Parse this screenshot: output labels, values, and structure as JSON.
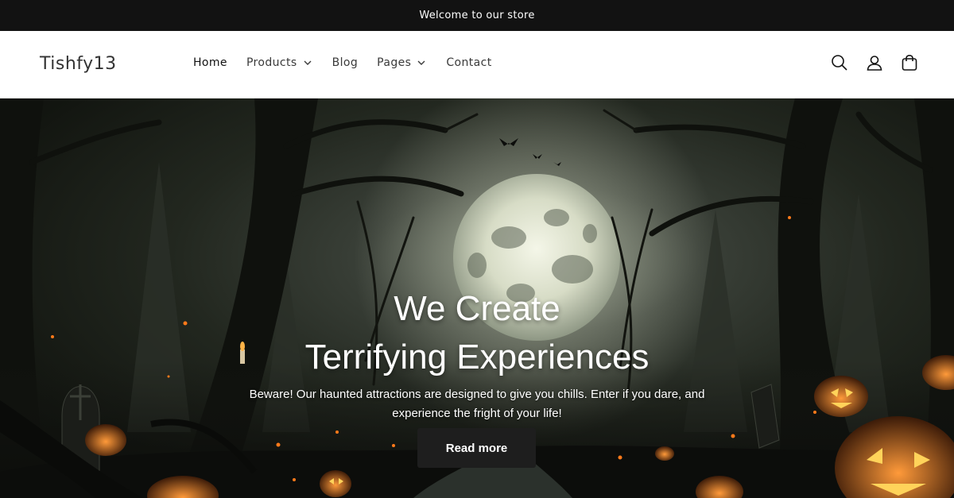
{
  "announcement": {
    "text": "Welcome to our store"
  },
  "header": {
    "logo": "Tishfy13",
    "nav": [
      {
        "label": "Home",
        "active": true,
        "has_dropdown": false
      },
      {
        "label": "Products",
        "active": false,
        "has_dropdown": true
      },
      {
        "label": "Blog",
        "active": false,
        "has_dropdown": false
      },
      {
        "label": "Pages",
        "active": false,
        "has_dropdown": true
      },
      {
        "label": "Contact",
        "active": false,
        "has_dropdown": false
      }
    ],
    "icons": [
      "search-icon",
      "account-icon",
      "cart-icon"
    ]
  },
  "hero": {
    "title_line1": "We Create",
    "title_line2": "Terrifying Experiences",
    "subtitle": "Beware! Our haunted attractions are designed to give you chills. Enter if you dare, and experience the fright of your life!",
    "button_label": "Read more"
  },
  "colors": {
    "announcement_bg": "#121212",
    "button_bg": "#1e1e1e",
    "pumpkin": "#ff7a1a"
  }
}
